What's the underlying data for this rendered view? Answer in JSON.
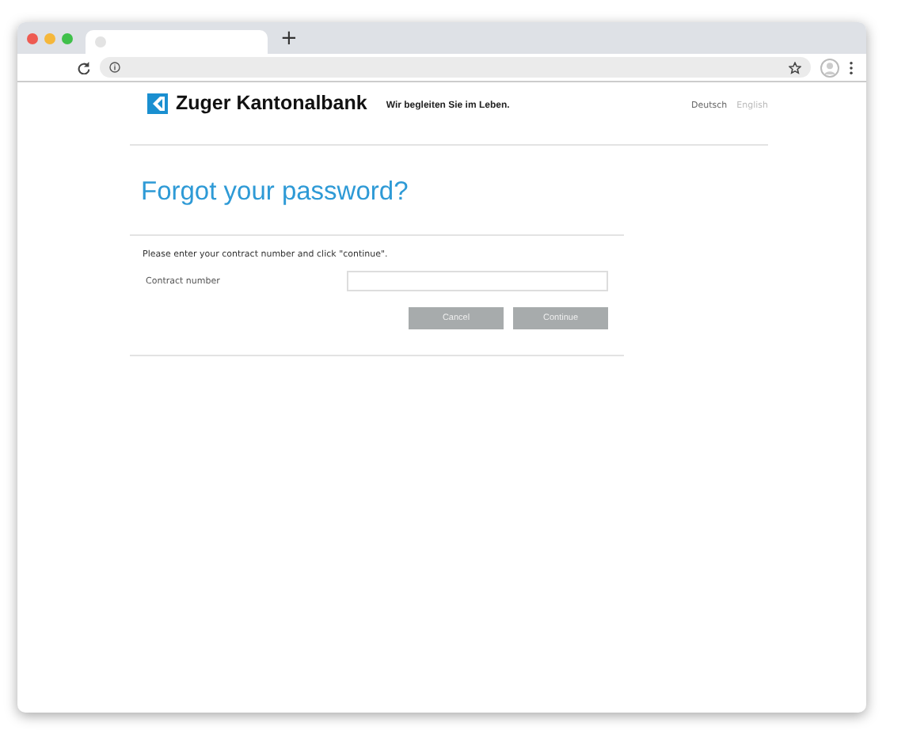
{
  "browser": {
    "new_tab": "+"
  },
  "header": {
    "brand": "Zuger Kantonalbank",
    "slogan": "Wir begleiten Sie im Leben.",
    "languages": [
      {
        "label": "Deutsch",
        "selected": true
      },
      {
        "label": "English",
        "selected": false
      }
    ]
  },
  "title": "Forgot your password?",
  "form": {
    "instructions": "Please enter your contract number and click \"continue\".",
    "field_label": "Contract number",
    "buttons": [
      "Cancel",
      "Continue"
    ]
  }
}
